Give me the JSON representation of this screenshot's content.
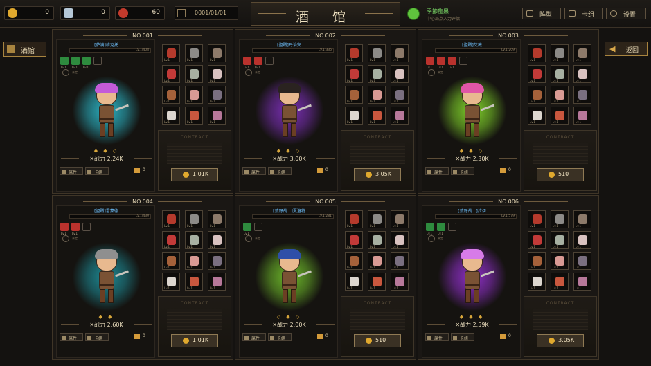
{
  "resources": [
    {
      "icon": "coin-icon",
      "value": "0",
      "color": "#e0a92e"
    },
    {
      "icon": "crystal-icon",
      "value": "0",
      "color": "#b5c7d6"
    },
    {
      "icon": "potion-icon",
      "value": "60",
      "color": "#c23a2c"
    }
  ],
  "date": "0001/01/01",
  "title": "酒 馆",
  "status": {
    "line1": "季節龍果",
    "line2": "中心局点入力评估"
  },
  "top_buttons": [
    {
      "label": "阵型",
      "icon": "formation-icon"
    },
    {
      "label": "卡组",
      "icon": "deck-icon"
    },
    {
      "label": "设置",
      "icon": "gear-icon"
    }
  ],
  "side_button": "酒馆",
  "back_button": {
    "label": "返回",
    "icon": "arrow-left-icon"
  },
  "labels": {
    "attr": "属性",
    "deck": "卡组",
    "contract": "CONTRACT",
    "no_skill": "未定",
    "power_prefix": "✕战力",
    "lv": "Lv.1"
  },
  "heroes": [
    {
      "no": "NO.001",
      "name": "[萨满]维克托",
      "lv": "LV.1/408",
      "power": "2.24K",
      "stars": "◆ ◆ ◇",
      "price": "1.01K",
      "bag": "0",
      "aura": "#2bb3c4",
      "hair": "#c35bd9",
      "skills": [
        "#2e8b3e",
        "#2e8b3e",
        "#2e8b3e"
      ]
    },
    {
      "no": "NO.002",
      "name": "[盗贼]丹治安",
      "lv": "LV.1/336",
      "power": "3.00K",
      "stars": "◆ ◆ ◇",
      "price": "3.05K",
      "bag": "0",
      "aura": "#7a2fb5",
      "hair": "#2a2320",
      "skills": [
        "#b9322d",
        "#b9322d"
      ]
    },
    {
      "no": "NO.003",
      "name": "[盗贼]艾薇",
      "lv": "LV.1/209",
      "power": "2.30K",
      "stars": "◆ ◆ ◇",
      "price": "510",
      "bag": "0",
      "aura": "#7fd12a",
      "hair": "#e056a6",
      "skills": [
        "#b9322d",
        "#b9322d",
        "#b9322d"
      ]
    },
    {
      "no": "NO.004",
      "name": "[盗贼]雷蒙德",
      "lv": "LV.1/430",
      "power": "2.60K",
      "stars": "◆ ◆",
      "price": "1.01K",
      "bag": "0",
      "aura": "#1d8a95",
      "hair": "#8f8f8f",
      "skills": [
        "#b9322d",
        "#b9322d"
      ]
    },
    {
      "no": "NO.005",
      "name": "[荒野战士]夏洛特",
      "lv": "LV.1/281",
      "power": "2.00K",
      "stars": "◇ ◆ ◇",
      "price": "510",
      "bag": "0",
      "aura": "#6db82a",
      "hair": "#2e4fa8",
      "skills": [
        "#2e8b3e"
      ]
    },
    {
      "no": "NO.006",
      "name": "[荒野战士]拉伊",
      "lv": "LV.1/579",
      "power": "2.59K",
      "stars": "◆ ◆ ◆",
      "price": "3.05K",
      "bag": "0",
      "aura": "#8e2fc7",
      "hair": "#d77be8",
      "skills": [
        "#2e8b3e",
        "#2e8b3e"
      ]
    }
  ],
  "equip_icons": [
    "sword-icon",
    "helmet-icon",
    "glove-icon",
    "shield-icon",
    "armor-icon",
    "pants-icon",
    "axe-icon",
    "chest-icon",
    "book-icon",
    "ring-icon",
    "boots-icon",
    "amulet-icon"
  ],
  "equip_colors": [
    "#b53a2c",
    "#8c8a87",
    "#8d7a6a",
    "#c23a38",
    "#a7b0a2",
    "#d9c2c0",
    "#a5613a",
    "#d99a94",
    "#7a6f80",
    "#dcd6cf",
    "#c9573e",
    "#b7789a"
  ]
}
